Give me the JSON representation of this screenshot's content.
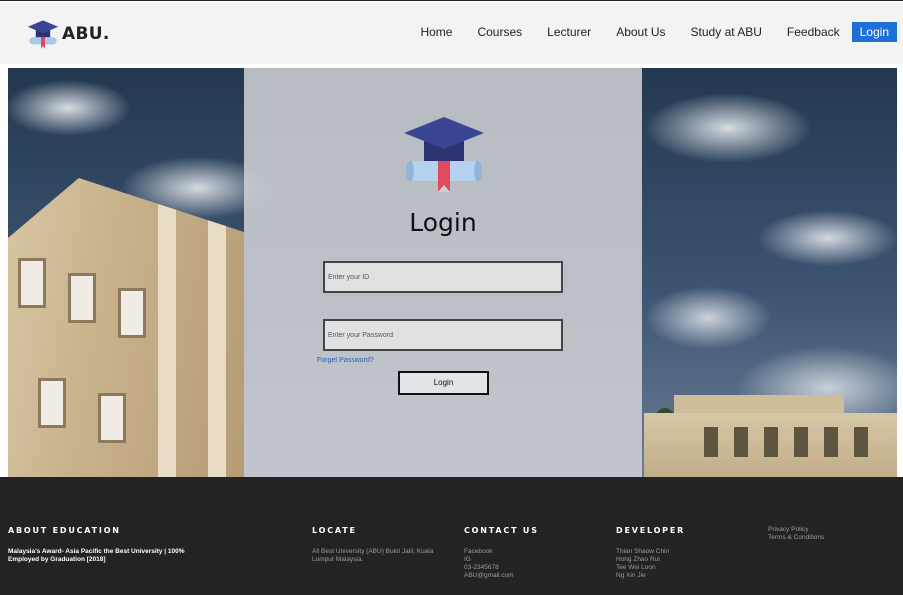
{
  "header": {
    "logo_text": "ABU.",
    "nav": [
      "Home",
      "Courses",
      "Lecturer",
      "About Us",
      "Study at ABU",
      "Feedback"
    ],
    "login_label": "Login"
  },
  "login_form": {
    "title": "Login",
    "id_placeholder": "Enter your ID",
    "password_placeholder": "Enter your Password",
    "forget_link": "Forget Password?",
    "submit_label": "Login"
  },
  "footer": {
    "about": {
      "heading": "ABOUT EDUCATION",
      "text": "Malaysia's Award- Asia Pacific the Best University | 100% Employed by Graduation [2018]"
    },
    "locate": {
      "heading": "LOCATE",
      "text": "All Best University (ABU) Bukit Jalil, Kuala Lumpur Malaysia."
    },
    "contact": {
      "heading": "CONTACT US",
      "items": [
        "Facebook",
        "IG",
        "03-2345678",
        "ABU@gmail.com"
      ]
    },
    "developer": {
      "heading": "DEVELOPER",
      "items": [
        "Thian Shaow Chin",
        "Hong Zhao Rui",
        "Tee Wei Loon",
        "Ng Xin Jie"
      ]
    },
    "legal": {
      "items": [
        "Privacy Policy",
        "Terms & Conditions"
      ]
    }
  },
  "colors": {
    "accent": "#1f6fd8",
    "footer_bg": "#232323",
    "header_bg": "#f3f3f3",
    "cap_navy": "#2f3a78",
    "ribbon_red": "#e04a5f"
  },
  "icons": {
    "logo": "graduation-cap-diploma-icon"
  }
}
